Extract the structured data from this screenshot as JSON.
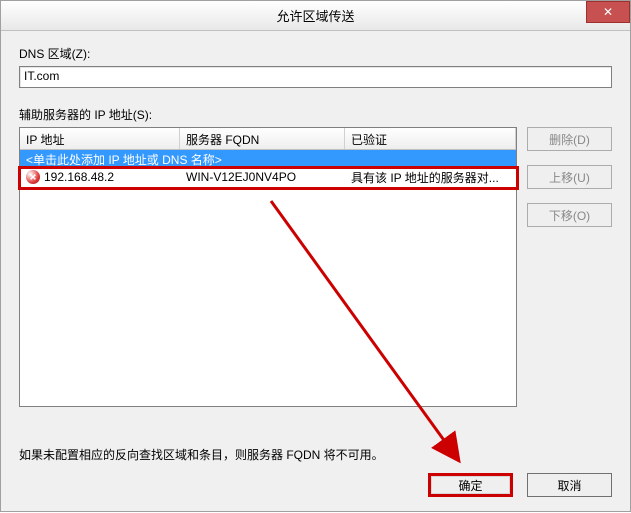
{
  "title": "允许区域传送",
  "close_symbol": "✕",
  "labels": {
    "dns_zone": "DNS 区域(Z):",
    "aux_servers": "辅助服务器的 IP 地址(S):"
  },
  "dns_zone_value": "IT.com",
  "columns": {
    "ip": "IP 地址",
    "fqdn": "服务器 FQDN",
    "validated": "已验证"
  },
  "prompt_row": "<单击此处添加 IP 地址或 DNS 名称>",
  "entries": [
    {
      "ip": "192.168.48.2",
      "fqdn": "WIN-V12EJ0NV4PO",
      "validated": "具有该 IP 地址的服务器对..."
    }
  ],
  "side_buttons": {
    "delete": "删除(D)",
    "move_up": "上移(U)",
    "move_down": "下移(O)"
  },
  "note": "如果未配置相应的反向查找区域和条目，则服务器 FQDN 将不可用。",
  "buttons": {
    "ok": "确定",
    "cancel": "取消"
  }
}
